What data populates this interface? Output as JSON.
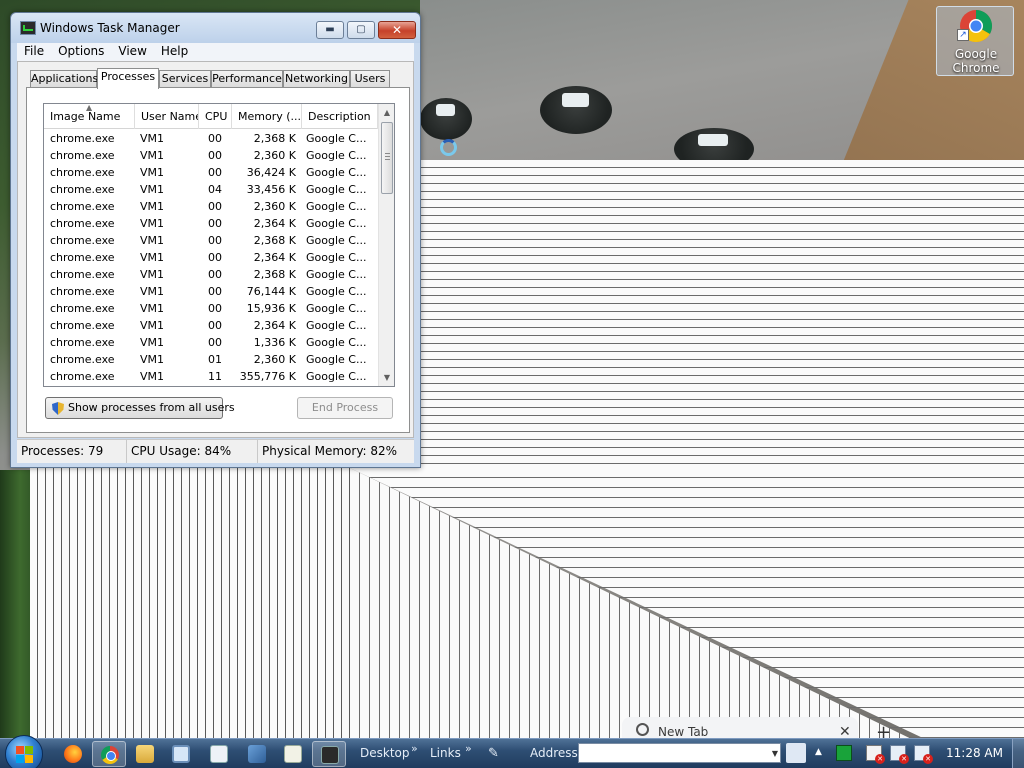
{
  "window": {
    "title": "Windows Task Manager",
    "min_glyph": "▬",
    "max_glyph": "▢",
    "close_glyph": "✕",
    "icon": "task-manager-icon"
  },
  "menu": [
    "File",
    "Options",
    "View",
    "Help"
  ],
  "tabs": [
    "Applications",
    "Processes",
    "Services",
    "Performance",
    "Networking",
    "Users"
  ],
  "active_tab": "Processes",
  "columns": [
    "Image Name",
    "User Name",
    "CPU",
    "Memory (...",
    "Description"
  ],
  "sort_column": "Image Name",
  "processes": [
    {
      "name": "chrome.exe",
      "user": "VM1",
      "cpu": "00",
      "mem": "2,368 K",
      "desc": "Google C..."
    },
    {
      "name": "chrome.exe",
      "user": "VM1",
      "cpu": "00",
      "mem": "2,360 K",
      "desc": "Google C..."
    },
    {
      "name": "chrome.exe",
      "user": "VM1",
      "cpu": "00",
      "mem": "36,424 K",
      "desc": "Google C..."
    },
    {
      "name": "chrome.exe",
      "user": "VM1",
      "cpu": "04",
      "mem": "33,456 K",
      "desc": "Google C..."
    },
    {
      "name": "chrome.exe",
      "user": "VM1",
      "cpu": "00",
      "mem": "2,360 K",
      "desc": "Google C..."
    },
    {
      "name": "chrome.exe",
      "user": "VM1",
      "cpu": "00",
      "mem": "2,364 K",
      "desc": "Google C..."
    },
    {
      "name": "chrome.exe",
      "user": "VM1",
      "cpu": "00",
      "mem": "2,368 K",
      "desc": "Google C..."
    },
    {
      "name": "chrome.exe",
      "user": "VM1",
      "cpu": "00",
      "mem": "2,364 K",
      "desc": "Google C..."
    },
    {
      "name": "chrome.exe",
      "user": "VM1",
      "cpu": "00",
      "mem": "2,368 K",
      "desc": "Google C..."
    },
    {
      "name": "chrome.exe",
      "user": "VM1",
      "cpu": "00",
      "mem": "76,144 K",
      "desc": "Google C..."
    },
    {
      "name": "chrome.exe",
      "user": "VM1",
      "cpu": "00",
      "mem": "15,936 K",
      "desc": "Google C..."
    },
    {
      "name": "chrome.exe",
      "user": "VM1",
      "cpu": "00",
      "mem": "2,364 K",
      "desc": "Google C..."
    },
    {
      "name": "chrome.exe",
      "user": "VM1",
      "cpu": "00",
      "mem": "1,336 K",
      "desc": "Google C..."
    },
    {
      "name": "chrome.exe",
      "user": "VM1",
      "cpu": "01",
      "mem": "2,360 K",
      "desc": "Google C..."
    },
    {
      "name": "chrome.exe",
      "user": "VM1",
      "cpu": "11",
      "mem": "355,776 K",
      "desc": "Google C..."
    }
  ],
  "buttons": {
    "show_all": "Show processes from all users",
    "end_process": "End Process"
  },
  "status": {
    "processes": "Processes: 79",
    "cpu": "CPU Usage: 84%",
    "memory": "Physical Memory: 82%"
  },
  "desktop_icon": {
    "label": "Google Chrome",
    "icon": "chrome-icon"
  },
  "browser_tab": {
    "title": "New Tab",
    "close": "✕",
    "new_tab": "+"
  },
  "taskbar": {
    "desktop_label": "Desktop",
    "links_label": "Links",
    "address_label": "Address",
    "address_value": "",
    "chevron": "»",
    "clock": "11:28 AM"
  },
  "colors": {
    "taskbar": "#2e4e73",
    "title_bar": "#c8d9ee",
    "close_button": "#c6412a"
  }
}
